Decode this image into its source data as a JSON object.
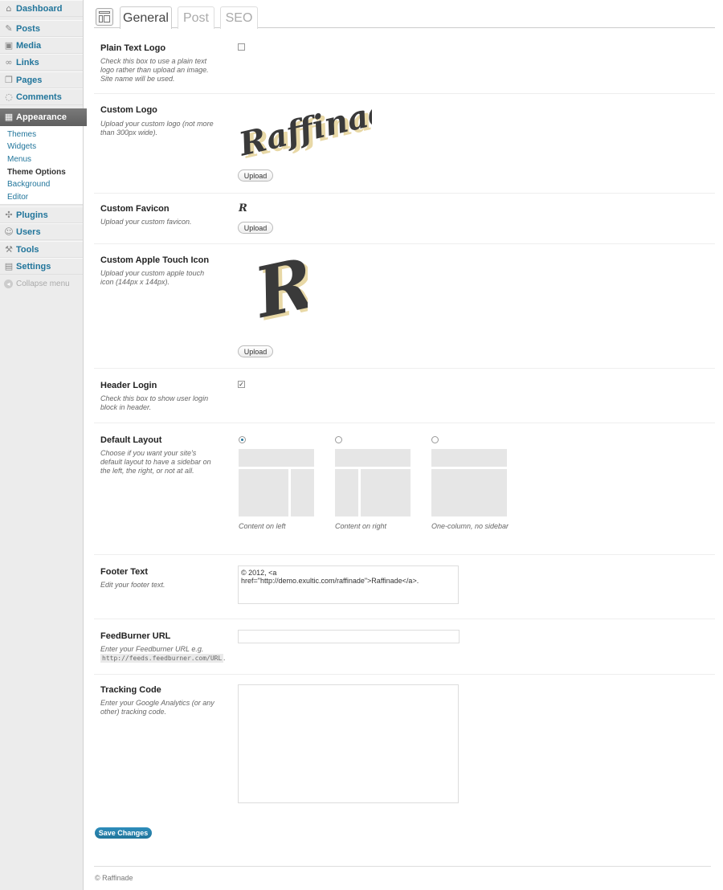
{
  "sidebar": {
    "items": [
      {
        "label": "Dashboard",
        "icon": "dashboard-icon"
      },
      {
        "label": "Posts",
        "icon": "pin-icon"
      },
      {
        "label": "Media",
        "icon": "media-icon"
      },
      {
        "label": "Links",
        "icon": "link-icon"
      },
      {
        "label": "Pages",
        "icon": "pages-icon"
      },
      {
        "label": "Comments",
        "icon": "comment-icon"
      },
      {
        "label": "Appearance",
        "icon": "appearance-icon"
      },
      {
        "label": "Plugins",
        "icon": "plugin-icon"
      },
      {
        "label": "Users",
        "icon": "users-icon"
      },
      {
        "label": "Tools",
        "icon": "tools-icon"
      },
      {
        "label": "Settings",
        "icon": "settings-icon"
      }
    ],
    "submenu": [
      "Themes",
      "Widgets",
      "Menus",
      "Theme Options",
      "Background",
      "Editor"
    ],
    "collapse_label": "Collapse menu"
  },
  "tabs": [
    "General",
    "Post",
    "SEO"
  ],
  "fields": {
    "plain_text_logo": {
      "label": "Plain Text Logo",
      "desc": "Check this box to use a plain text logo rather than upload an image. Site name will be used.",
      "checked": false
    },
    "custom_logo": {
      "label": "Custom Logo",
      "desc": "Upload your custom logo (not more than 300px wide).",
      "logo_text": "Raffinade"
    },
    "custom_favicon": {
      "label": "Custom Favicon",
      "desc": "Upload your custom favicon."
    },
    "apple_touch_icon": {
      "label": "Custom Apple Touch Icon",
      "desc": "Upload your custom apple touch icon (144px x 144px).",
      "letter": "R"
    },
    "header_login": {
      "label": "Header Login",
      "desc": "Check this box to show user login block in header.",
      "checked": true
    },
    "default_layout": {
      "label": "Default Layout",
      "desc": "Choose if you want your site's default layout to have a sidebar on the left, the right, or not at all.",
      "options": [
        "Content on left",
        "Content on right",
        "One-column, no sidebar"
      ],
      "selected": "Content on left"
    },
    "footer_text": {
      "label": "Footer Text",
      "desc": "Edit your footer text.",
      "value": "© 2012, <a href=\"http://demo.exultic.com/raffinade\">Raffinade</a>."
    },
    "feedburner_url": {
      "label": "FeedBurner URL",
      "desc": "Enter your Feedburner URL e.g.",
      "example": "http://feeds.feedburner.com/URL",
      "value": ""
    },
    "tracking_code": {
      "label": "Tracking Code",
      "desc": "Enter your Google Analytics (or any other) tracking code.",
      "value": ""
    }
  },
  "upload_label": "Upload",
  "save_label": "Save Changes",
  "footer_copyright": "© Raffinade",
  "colors": {
    "accent": "#21759b",
    "active_menu": "#6d6d6d"
  }
}
